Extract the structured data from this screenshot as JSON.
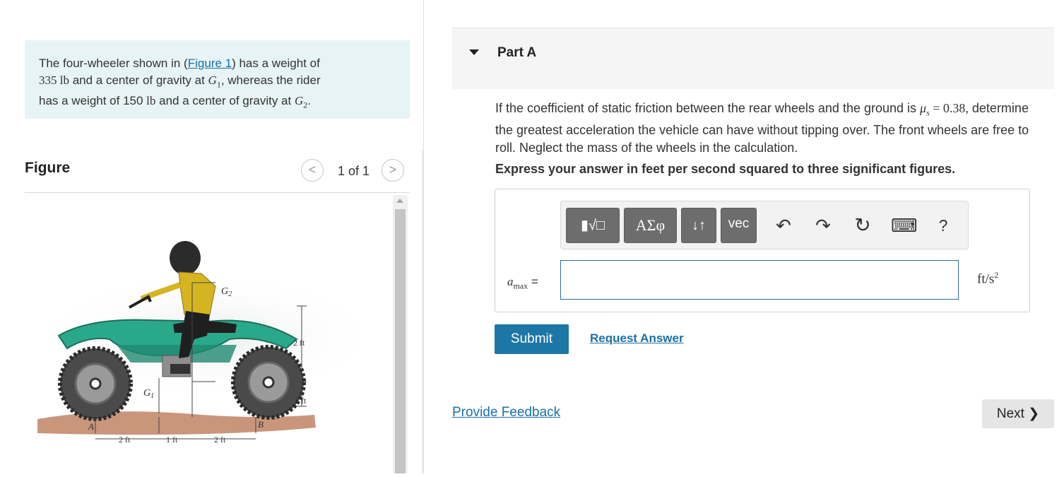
{
  "problem": {
    "intro": "The four-wheeler shown in (",
    "figure_link": "Figure 1",
    "after_link": ") has a weight of",
    "w1": "335 lb",
    "t2": " and a center of gravity at ",
    "g1": "G",
    "g1_sub": "1",
    "t3": ", whereas the rider",
    "t4": "has a weight of 150 ",
    "lb": "lb",
    "t5": " and a center of gravity at ",
    "g2": "G",
    "g2_sub": "2",
    "t6": "."
  },
  "figure": {
    "label": "Figure",
    "prev": "<",
    "next": ">",
    "pager": "1 of 1",
    "labels": {
      "g1": "G",
      "g1_sub": "1",
      "g2": "G",
      "g2_sub": "2",
      "a": "A",
      "b": "B",
      "dim_2ft_vertical": "2 ft",
      "dim_1ft_vertical": "1 ft",
      "dim_2ft_left": "2 ft",
      "dim_1ft": "1 ft",
      "dim_2ft_right": "2 ft"
    }
  },
  "part": {
    "title": "Part A",
    "question_1": "If the coefficient of static friction between the rear wheels and the ground is ",
    "mu": "μ",
    "mu_sub": "s",
    "eq": " = 0.38,",
    "question_2": "determine the greatest acceleration the vehicle can have without tipping over. The front wheels are free to roll. Neglect the mass of the wheels in the calculation.",
    "instruction": "Express your answer in feet per second squared to three significant figures."
  },
  "toolbar": {
    "templates": "▮√□",
    "greek": "ΑΣφ",
    "arrows": "↓↑",
    "vec": "vec",
    "undo": "↶",
    "redo": "↷",
    "reset": "↻",
    "keyboard": "⌨",
    "help": "?"
  },
  "answer": {
    "var": "a",
    "var_sub": "max",
    "equals": " =",
    "value": "",
    "unit": "ft/s",
    "unit_sup": "2"
  },
  "actions": {
    "submit": "Submit",
    "request_answer": "Request Answer",
    "provide_feedback": "Provide Feedback",
    "next": "Next ❯"
  }
}
